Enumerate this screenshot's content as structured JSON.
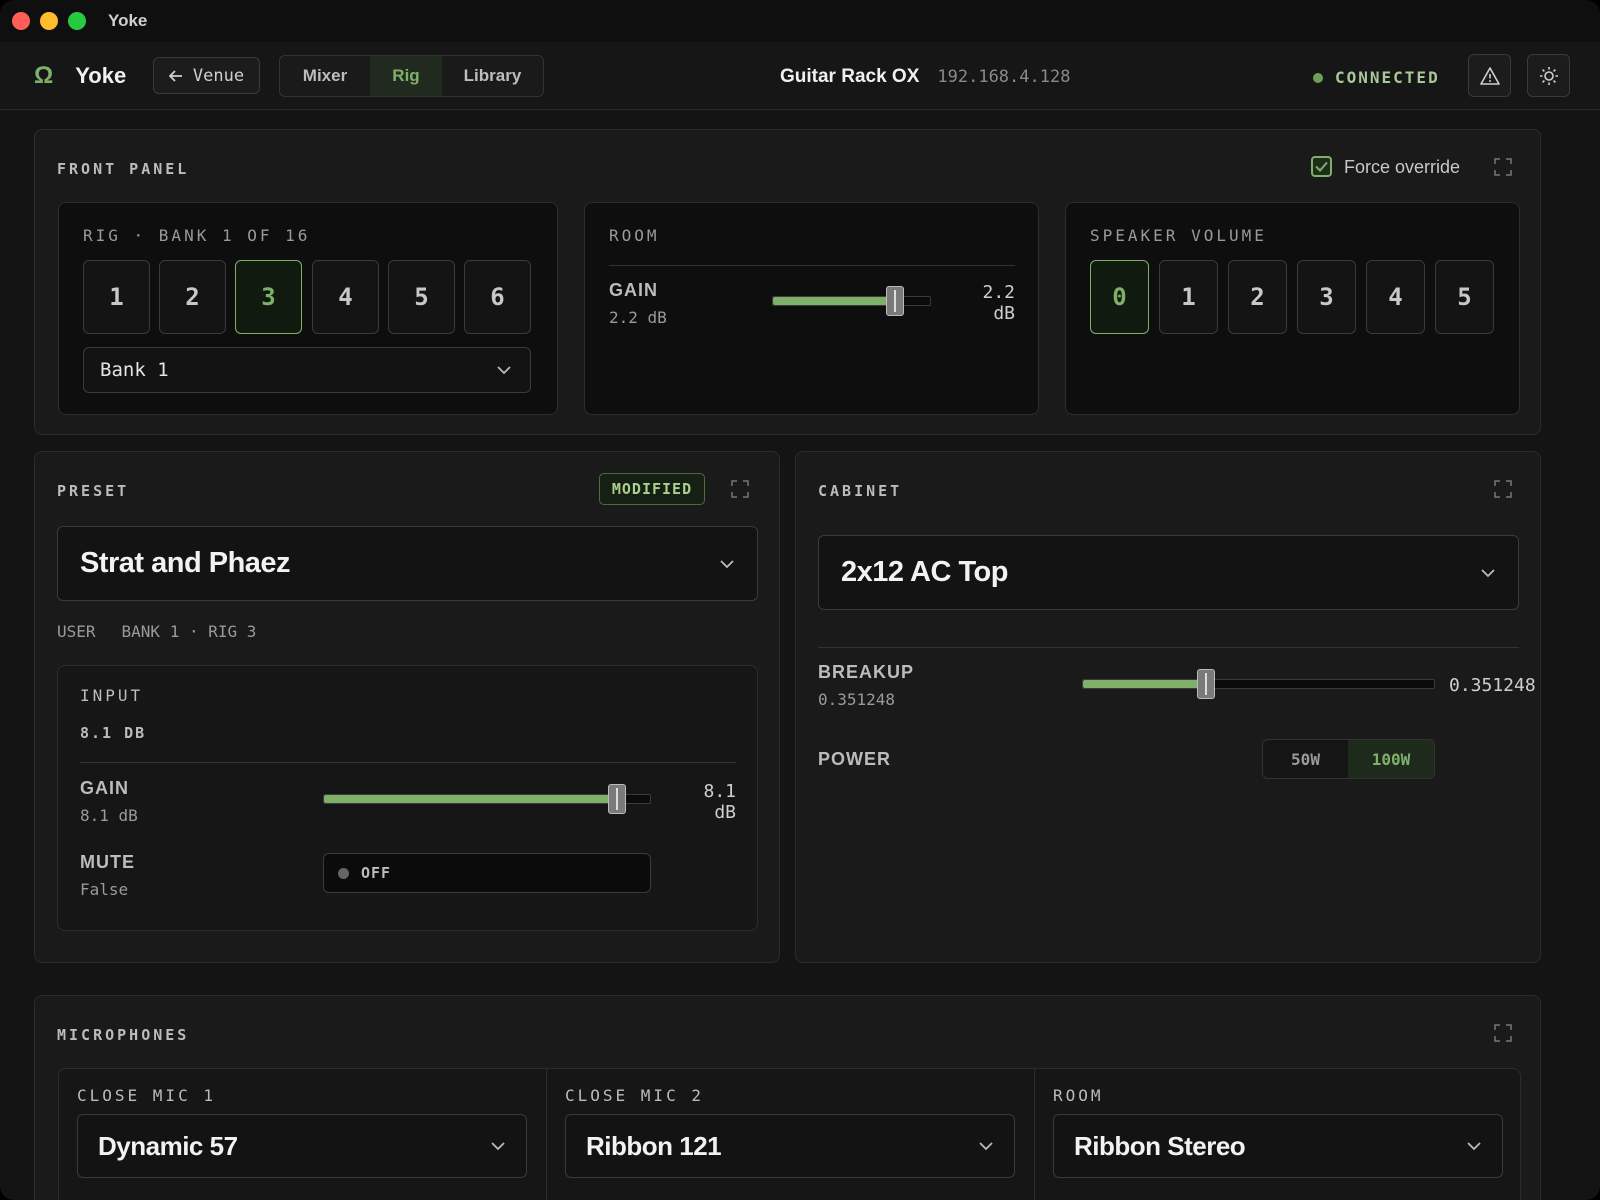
{
  "window": {
    "title": "Yoke"
  },
  "toolbar": {
    "brand_glyph": "Ω",
    "brand_name": "Yoke",
    "venue_label": "Venue",
    "tabs": [
      {
        "label": "Mixer",
        "active": false
      },
      {
        "label": "Rig",
        "active": true
      },
      {
        "label": "Library",
        "active": false
      }
    ],
    "device_name": "Guitar Rack OX",
    "device_ip": "192.168.4.128",
    "status": "CONNECTED",
    "accent_color": "#7fb069"
  },
  "front_panel": {
    "title": "FRONT PANEL",
    "force_override_label": "Force override",
    "force_override_checked": true,
    "rig": {
      "label": "RIG · BANK 1 OF 16",
      "buttons": [
        "1",
        "2",
        "3",
        "4",
        "5",
        "6"
      ],
      "selected": "3",
      "bank_value": "Bank 1"
    },
    "room": {
      "label": "ROOM",
      "gain_name": "GAIN",
      "gain_value": "2.2 dB",
      "gain_right_num": "2.2",
      "gain_right_unit": "dB",
      "gain_fraction": 0.78
    },
    "speaker_volume": {
      "label": "SPEAKER VOLUME",
      "buttons": [
        "0",
        "1",
        "2",
        "3",
        "4",
        "5"
      ],
      "selected": "0"
    }
  },
  "preset": {
    "title": "PRESET",
    "badge": "MODIFIED",
    "name": "Strat and Phaez",
    "meta_source": "USER",
    "meta_location": "BANK 1 · RIG 3",
    "input": {
      "label": "INPUT",
      "value": "8.1 DB",
      "gain_name": "GAIN",
      "gain_value": "8.1 dB",
      "gain_right_num": "8.1",
      "gain_right_unit": "dB",
      "gain_fraction": 0.9,
      "mute_name": "MUTE",
      "mute_value": "False",
      "mute_toggle_label": "OFF"
    }
  },
  "cabinet": {
    "title": "CABINET",
    "name": "2x12 AC Top",
    "breakup_name": "BREAKUP",
    "breakup_value": "0.351248",
    "breakup_right": "0.351248",
    "breakup_fraction": 0.351248,
    "power_name": "POWER",
    "power_options": [
      "50W",
      "100W"
    ],
    "power_selected": "100W"
  },
  "microphones": {
    "title": "MICROPHONES",
    "slots": [
      {
        "label": "CLOSE MIC 1",
        "value": "Dynamic 57"
      },
      {
        "label": "CLOSE MIC 2",
        "value": "Ribbon 121"
      },
      {
        "label": "ROOM",
        "value": "Ribbon Stereo"
      }
    ]
  }
}
